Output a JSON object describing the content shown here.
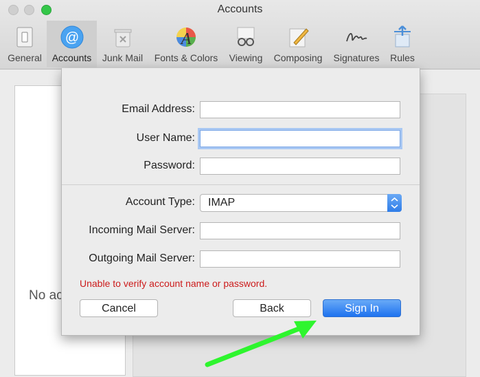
{
  "window": {
    "title": "Accounts"
  },
  "toolbar": {
    "items": [
      {
        "label": "General",
        "icon": "general-icon"
      },
      {
        "label": "Accounts",
        "icon": "at-sign-icon",
        "selected": true
      },
      {
        "label": "Junk Mail",
        "icon": "trash-icon"
      },
      {
        "label": "Fonts & Colors",
        "icon": "fonts-icon"
      },
      {
        "label": "Viewing",
        "icon": "glasses-icon"
      },
      {
        "label": "Composing",
        "icon": "pencil-icon"
      },
      {
        "label": "Signatures",
        "icon": "signature-icon"
      },
      {
        "label": "Rules",
        "icon": "rules-icon"
      }
    ]
  },
  "background": {
    "no_accounts_text": "No ac"
  },
  "sheet": {
    "email_label": "Email Address:",
    "email_value": "",
    "username_label": "User Name:",
    "username_value": "",
    "password_label": "Password:",
    "password_value": "",
    "account_type_label": "Account Type:",
    "account_type_value": "IMAP",
    "incoming_label": "Incoming Mail Server:",
    "incoming_value": "",
    "outgoing_label": "Outgoing Mail Server:",
    "outgoing_value": "",
    "error_message": "Unable to verify account name or password.",
    "cancel_label": "Cancel",
    "back_label": "Back",
    "signin_label": "Sign In"
  },
  "colors": {
    "accent": "#1e72ef",
    "error": "#cc1b1b",
    "annotation_arrow": "#2ef52e"
  }
}
